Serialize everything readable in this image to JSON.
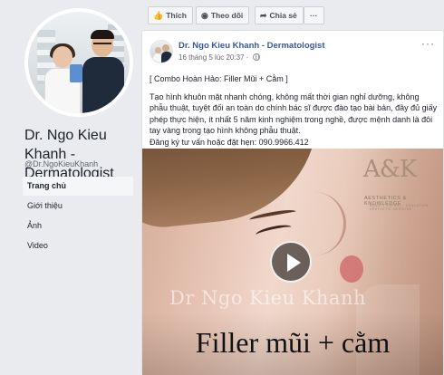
{
  "sidebar": {
    "page_name": "Dr. Ngo Kieu Khanh - Dermatologist",
    "handle": "@Dr.NgoKieuKhanh",
    "nav": [
      {
        "label": "Trang chủ"
      },
      {
        "label": "Giới thiệu"
      },
      {
        "label": "Ảnh"
      },
      {
        "label": "Video"
      }
    ]
  },
  "actions": {
    "like": "Thích",
    "follow": "Theo dõi",
    "share": "Chia sẻ",
    "more": "···"
  },
  "post": {
    "author": "Dr. Ngo Kieu Khanh - Dermatologist",
    "timestamp": "16 tháng 5 lúc 20:37",
    "more": "···",
    "headline": "[ Combo Hoàn Hảo: Filler Mũi + Cằm ]",
    "body": "Tạo hình khuôn mặt nhanh chóng, không mất thời gian nghỉ dưỡng, không phẫu thuật, tuyệt đối an toàn do chính bác sĩ được đào tạo bài bản, đầy đủ giấy phép thực hiện, ít nhất 5 năm kinh nghiệm trong nghề, được mệnh danh là đôi tay vàng trong tạo hình không phẫu thuật.",
    "contact": "Đăng ký tư vấn hoặc đặt hẹn: 090.9966.412"
  },
  "video": {
    "brand_logo": "A&K",
    "brand_sub": "AESTHETICS & KNOWLEDGE",
    "brand_sub2": "BEAUTY EXPERT · EDUCATION · AESTHETIC MEDICINE",
    "watermark": "Dr Ngo Kieu Khanh",
    "caption": "Filler mũi + cằm"
  }
}
